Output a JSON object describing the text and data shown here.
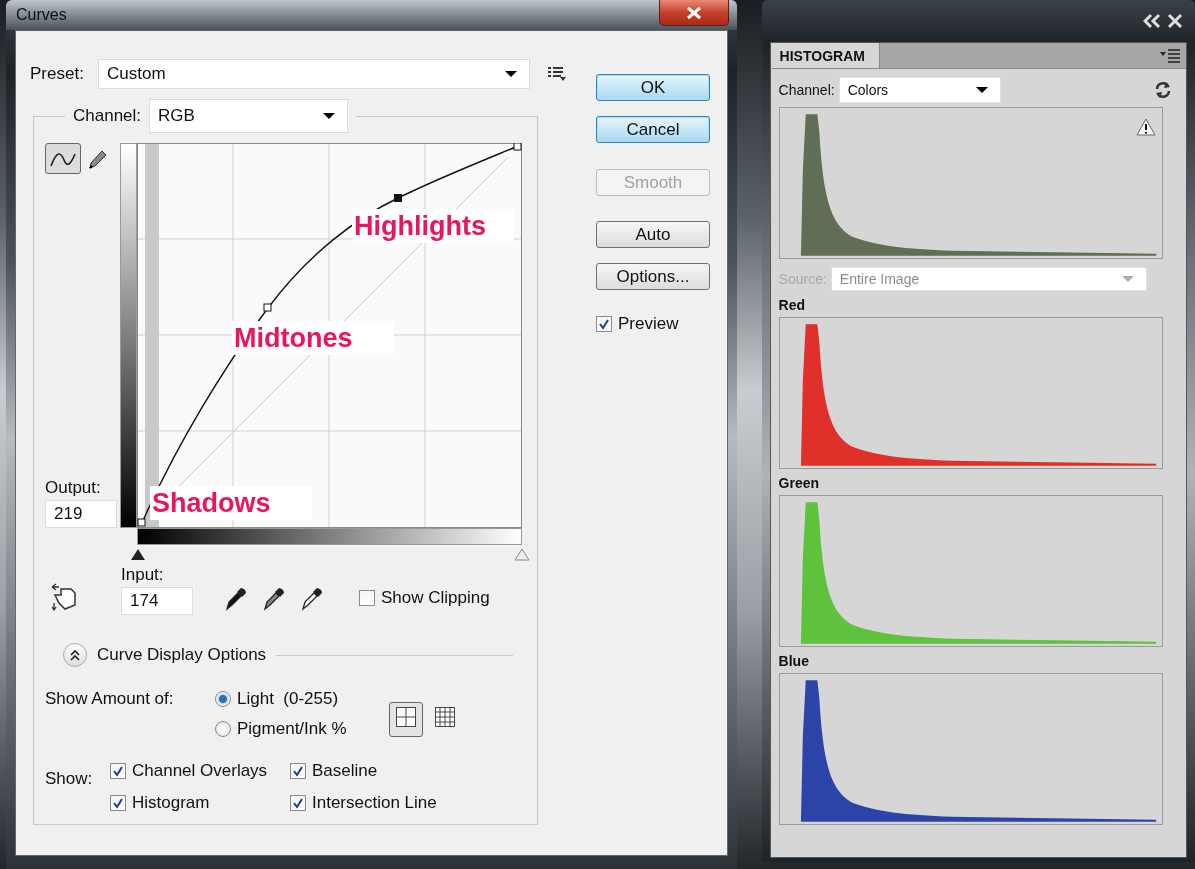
{
  "curves_dialog": {
    "title": "Curves",
    "preset": {
      "label": "Preset:",
      "value": "Custom"
    },
    "channel": {
      "label": "Channel:",
      "value": "RGB"
    },
    "buttons": [
      {
        "label": "OK",
        "highlighted": true,
        "disabled": false
      },
      {
        "label": "Cancel",
        "highlighted": true,
        "disabled": false
      },
      {
        "label": "Smooth",
        "highlighted": false,
        "disabled": true
      },
      {
        "label": "Auto",
        "highlighted": false,
        "disabled": false
      },
      {
        "label": "Options...",
        "highlighted": false,
        "disabled": false
      }
    ],
    "preview": {
      "label": "Preview",
      "checked": true
    },
    "annotations": [
      {
        "text": "Highlights"
      },
      {
        "text": "Midtones"
      },
      {
        "text": "Shadows"
      }
    ],
    "output": {
      "label": "Output:",
      "value": "219"
    },
    "input": {
      "label": "Input:",
      "value": "174"
    },
    "show_clipping": {
      "label": "Show Clipping",
      "checked": false
    },
    "display_options": {
      "label": "Curve Display Options",
      "expanded": true
    },
    "show_amount": {
      "label": "Show Amount of:",
      "options": [
        {
          "label": "Light  (0-255)",
          "selected": true
        },
        {
          "label": "Pigment/Ink %",
          "selected": false
        }
      ]
    },
    "grid_buttons": [
      {
        "selected": true
      },
      {
        "selected": false
      }
    ],
    "show": {
      "label": "Show:",
      "options": [
        {
          "label": "Channel Overlays",
          "checked": true
        },
        {
          "label": "Baseline",
          "checked": true
        },
        {
          "label": "Histogram",
          "checked": true
        },
        {
          "label": "Intersection Line",
          "checked": true
        }
      ]
    }
  },
  "histogram_panel": {
    "tab": "HISTOGRAM",
    "channel": {
      "label": "Channel:",
      "value": "Colors"
    },
    "source": {
      "label": "Source:",
      "value": "Entire Image",
      "disabled": true
    },
    "channels": [
      {
        "name": "Red",
        "color": "#e0302a"
      },
      {
        "name": "Green",
        "color": "#5ec23c"
      },
      {
        "name": "Blue",
        "color": "#2c44a8"
      }
    ]
  }
}
